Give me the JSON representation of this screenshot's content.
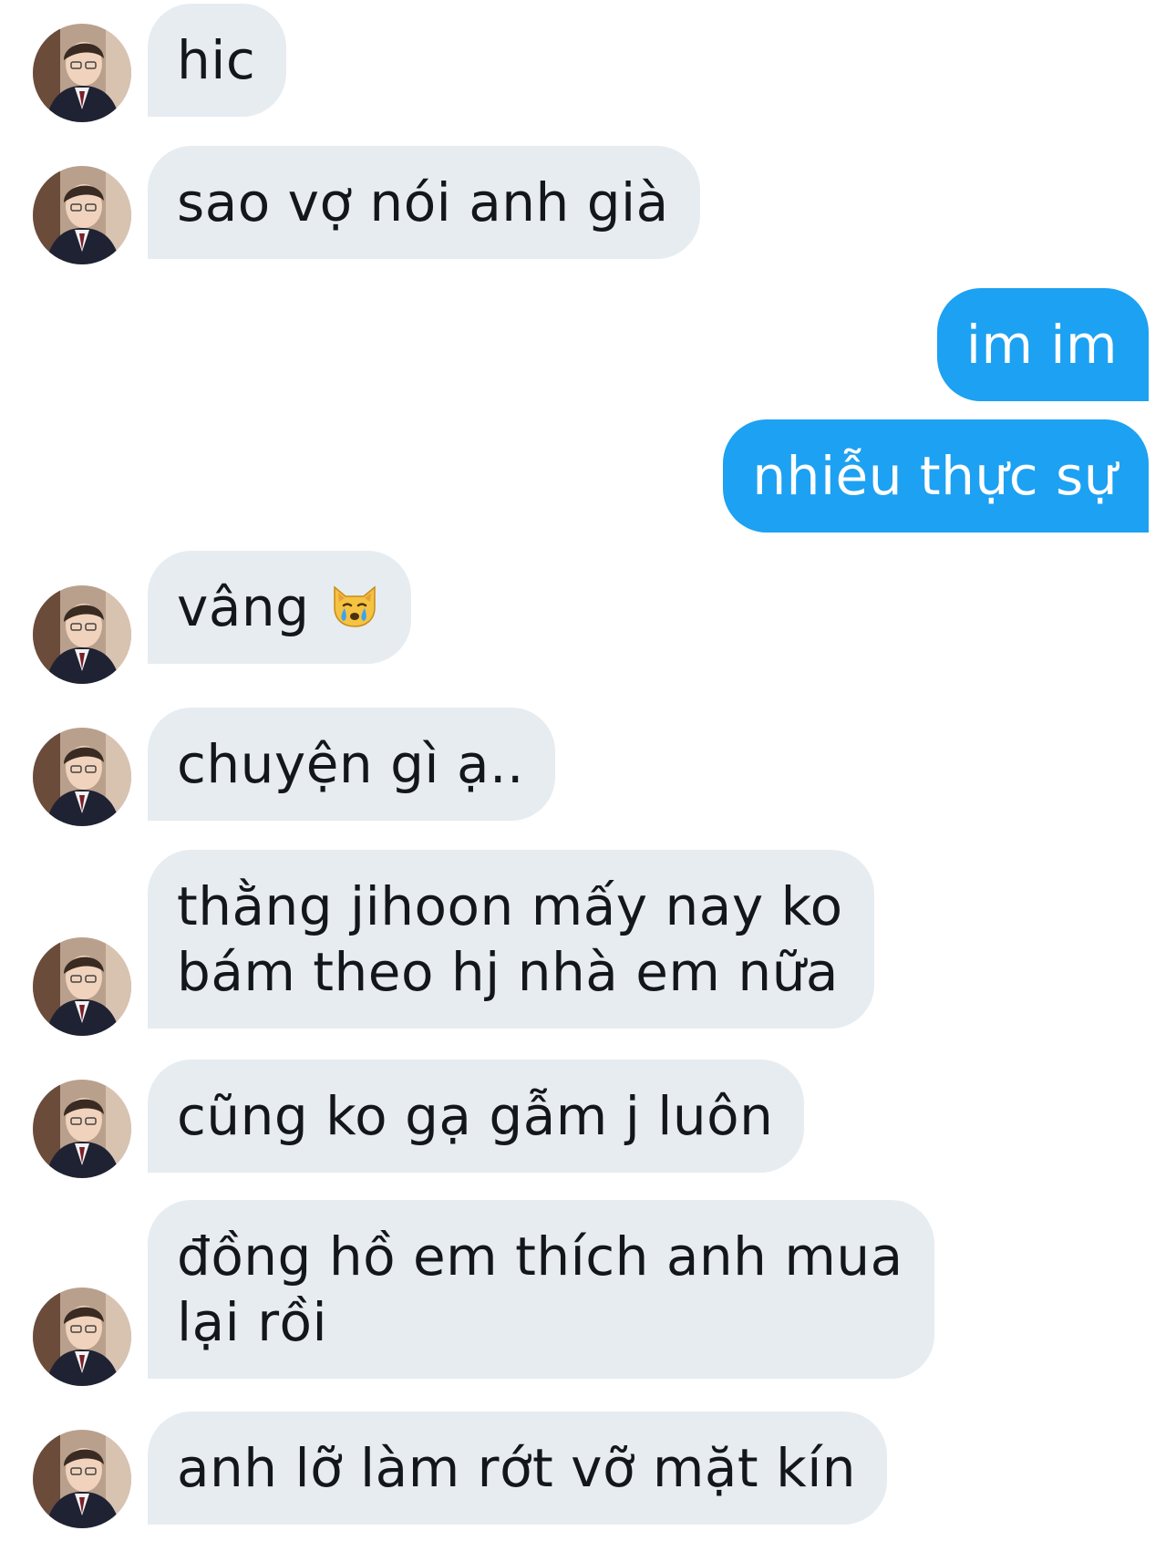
{
  "colors": {
    "incoming_bubble": "#e6ecf0",
    "outgoing_bubble": "#1da1f2",
    "incoming_text": "#14171a",
    "outgoing_text": "#ffffff"
  },
  "messages": [
    {
      "direction": "incoming",
      "lines": [
        "hic"
      ]
    },
    {
      "direction": "incoming",
      "lines": [
        "sao vợ nói anh già"
      ]
    },
    {
      "direction": "outgoing",
      "lines": [
        "im im"
      ]
    },
    {
      "direction": "outgoing",
      "lines": [
        "nhiễu thực sự"
      ]
    },
    {
      "direction": "incoming",
      "lines": [
        "vâng"
      ],
      "emoji": "crying-cat-face"
    },
    {
      "direction": "incoming",
      "lines": [
        "chuyện gì ạ.."
      ]
    },
    {
      "direction": "incoming",
      "lines": [
        "thằng jihoon mấy nay ko",
        "bám theo hj nhà em nữa"
      ]
    },
    {
      "direction": "incoming",
      "lines": [
        "cũng ko gạ gẫm j luôn"
      ]
    },
    {
      "direction": "incoming",
      "lines": [
        "đồng hồ em thích anh mua",
        "lại rồi"
      ]
    },
    {
      "direction": "incoming",
      "lines": [
        "anh lỡ làm rớt vỡ mặt kín"
      ]
    }
  ]
}
